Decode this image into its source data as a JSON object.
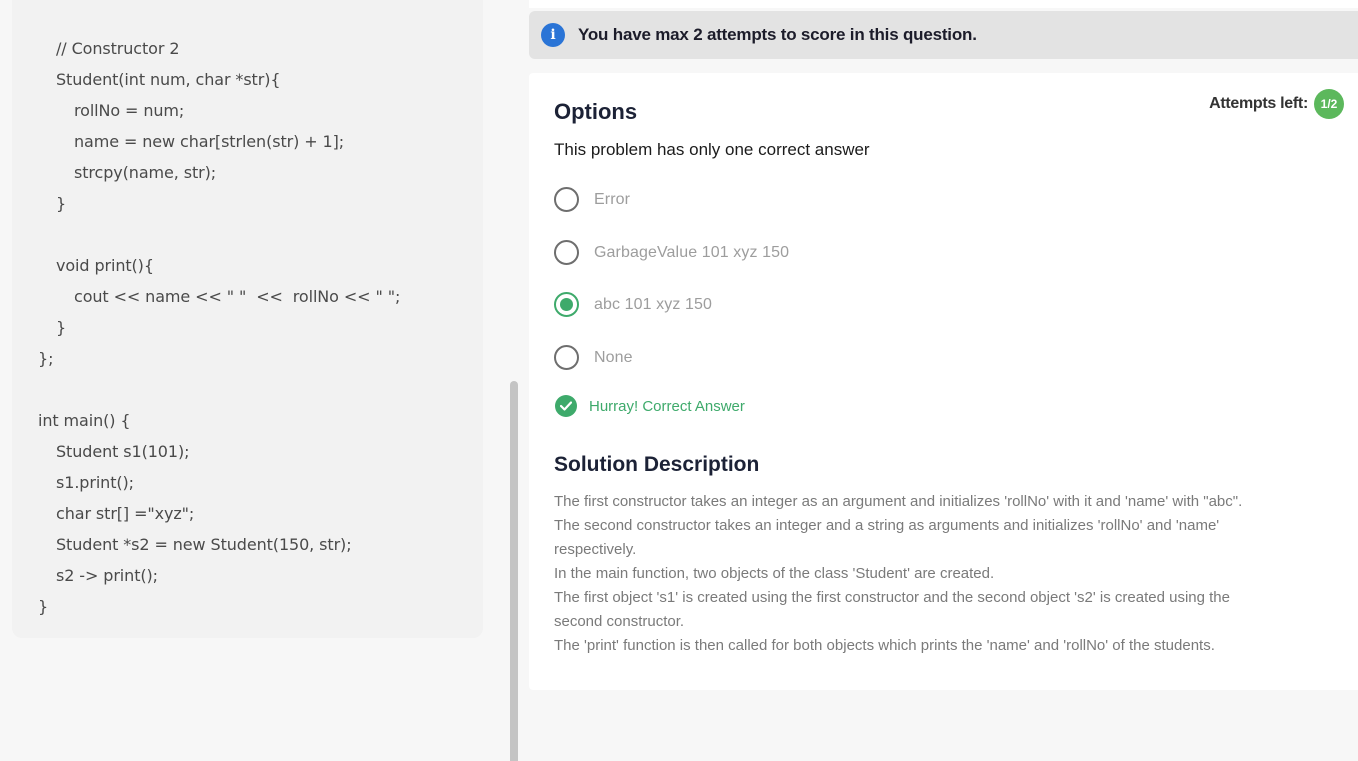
{
  "code": {
    "lines": [
      "// Constructor 2",
      "Student(int num, char *str){",
      "rollNo = num;",
      "name = new char[strlen(str) + 1];",
      "strcpy(name, str);",
      "}",
      "void print(){",
      "cout << name << \" \"  <<  rollNo << \" \";",
      "}",
      "};",
      "int main() {",
      "Student s1(101);",
      "s1.print();",
      "char str[] =\"xyz\";",
      "Student *s2 = new Student(150, str);",
      "s2 -> print();",
      "}"
    ]
  },
  "banner": {
    "icon": "info-icon",
    "text": "You have max 2 attempts to score in this question."
  },
  "options_section": {
    "title": "Options",
    "attempts_label": "Attempts left:",
    "attempts_value": "1/2",
    "note": "This problem has only one correct answer",
    "options": [
      {
        "label": "Error",
        "selected": false
      },
      {
        "label": "GarbageValue 101 xyz 150",
        "selected": false
      },
      {
        "label": "abc 101 xyz 150",
        "selected": true
      },
      {
        "label": "None",
        "selected": false
      }
    ],
    "result": "Hurray! Correct Answer"
  },
  "solution": {
    "title": "Solution Description",
    "lines": [
      "The first constructor takes an integer as an argument and initializes 'rollNo' with it and 'name' with \"abc\".",
      "The second constructor takes an integer and a string as arguments and initializes 'rollNo' and 'name'",
      "respectively.",
      "In the main function, two objects of the class 'Student' are created.",
      "The first object 's1' is created using the first constructor and the second object 's2' is created using the",
      "second constructor.",
      "The 'print' function is then called for both objects which prints the 'name' and 'rollNo' of the students."
    ]
  },
  "colors": {
    "accent_green": "#3eaa6b",
    "info_blue": "#2a74d6",
    "badge_green": "#5cb85c"
  }
}
